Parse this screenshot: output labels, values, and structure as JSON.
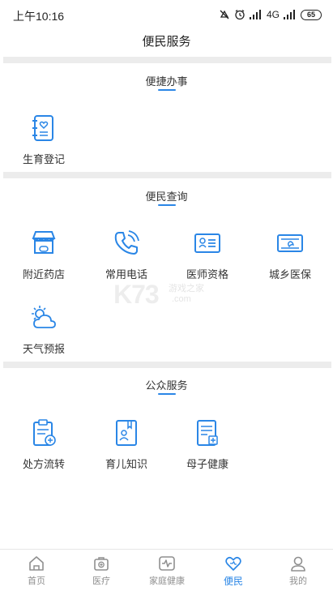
{
  "status_bar": {
    "time": "上午10:16",
    "network": "4G",
    "battery": "65"
  },
  "header": {
    "title": "便民服务"
  },
  "sections": {
    "quick": {
      "title": "便捷办事",
      "items": [
        {
          "label": "生育登记",
          "icon": "birth-registration-icon"
        }
      ]
    },
    "query": {
      "title": "便民查询",
      "items": [
        {
          "label": "附近药店",
          "icon": "pharmacy-store-icon"
        },
        {
          "label": "常用电话",
          "icon": "phone-icon"
        },
        {
          "label": "医师资格",
          "icon": "id-card-icon"
        },
        {
          "label": "城乡医保",
          "icon": "insurance-card-icon"
        },
        {
          "label": "天气预报",
          "icon": "weather-icon"
        }
      ]
    },
    "public": {
      "title": "公众服务",
      "items": [
        {
          "label": "处方流转",
          "icon": "prescription-icon"
        },
        {
          "label": "育儿知识",
          "icon": "parenting-book-icon"
        },
        {
          "label": "母子健康",
          "icon": "maternal-health-icon"
        }
      ]
    }
  },
  "watermark": {
    "brand": "K73",
    "sub": "游戏之家",
    "domain": ".com"
  },
  "bottom_nav": {
    "items": [
      {
        "label": "首页",
        "icon": "home-icon"
      },
      {
        "label": "医疗",
        "icon": "medical-kit-icon"
      },
      {
        "label": "家庭健康",
        "icon": "heartbeat-monitor-icon"
      },
      {
        "label": "便民",
        "icon": "heart-icon"
      },
      {
        "label": "我的",
        "icon": "user-icon"
      }
    ],
    "active_index": 3
  },
  "colors": {
    "accent": "#2a86e6",
    "divider": "#ececec",
    "text": "#333333",
    "nav_inactive": "#8f8f8f"
  }
}
